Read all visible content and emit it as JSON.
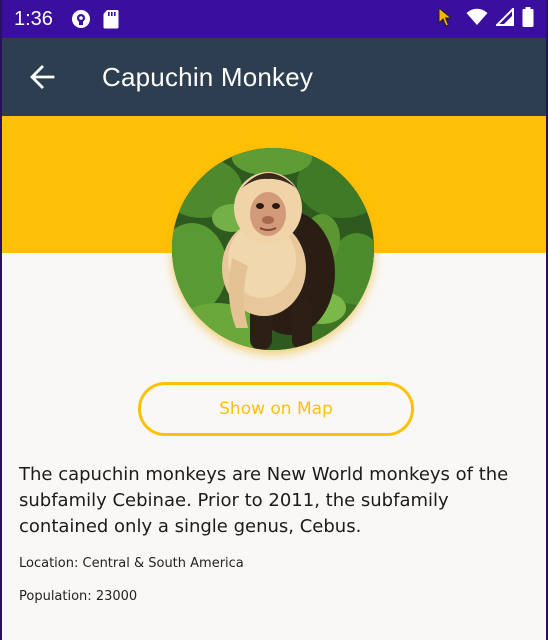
{
  "status_bar": {
    "time": "1:36",
    "icons": [
      "podcast-icon",
      "sd-card-icon",
      "cursor-icon",
      "wifi-icon",
      "signal-icon",
      "battery-icon"
    ]
  },
  "app_bar": {
    "back_icon": "arrow-left-icon",
    "title": "Capuchin Monkey"
  },
  "monkey": {
    "image_alt": "Capuchin Monkey",
    "details": "The capuchin monkeys are New World monkeys of the subfamily Cebinae. Prior to 2011, the subfamily contained only a single genus, Cebus.",
    "location": "Location: Central & South America",
    "population": "Population: 23000"
  },
  "actions": {
    "show_on_map_label": "Show on Map"
  },
  "colors": {
    "status_bar": "#3a0fa0",
    "app_bar": "#2c3e50",
    "accent": "#ffc107",
    "background": "#faf8f6"
  }
}
